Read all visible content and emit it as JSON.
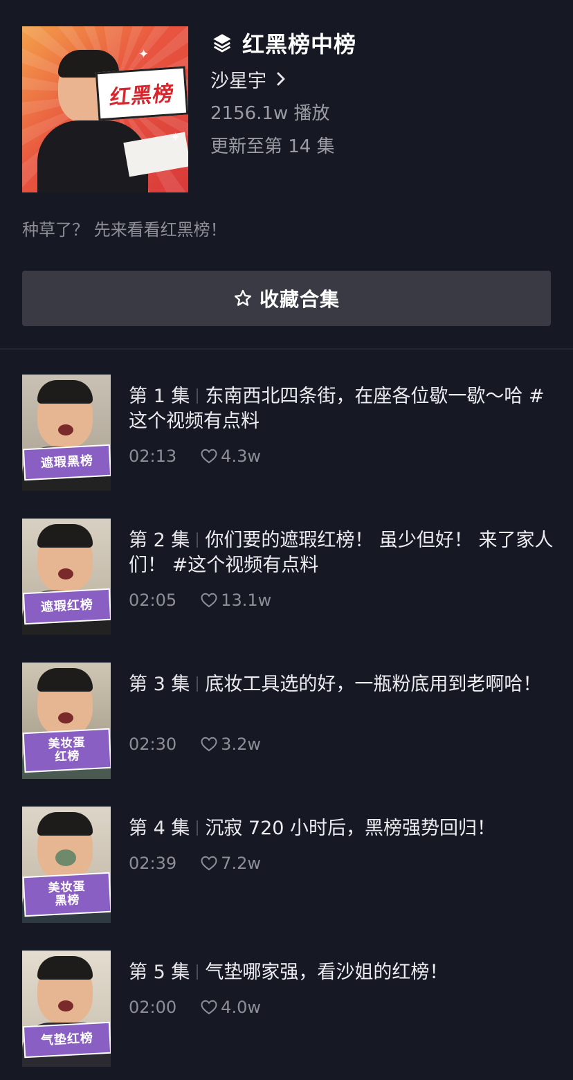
{
  "collection": {
    "cover_text": "红黑榜",
    "title": "红黑榜中榜",
    "author": "沙星宇",
    "plays": "2156.1w 播放",
    "updated": "更新至第 14 集",
    "description": "种草了？ 先来看看红黑榜！",
    "collect_label": "收藏合集"
  },
  "icons": {
    "title_icon": "layers-icon",
    "author_chevron": "chevron-right-icon",
    "collect_icon": "star-outline-icon",
    "like_icon": "heart-outline-icon"
  },
  "colors": {
    "background": "#161823",
    "button": "#393a43",
    "thumb_banner": "#8a5fc4"
  },
  "episodes": [
    {
      "number": "第 1 集",
      "title": "东南西北四条街，在座各位歇一歇～哈 #这个视频有点料",
      "duration": "02:13",
      "likes": "4.3w",
      "banner": [
        "遮瑕黑榜"
      ]
    },
    {
      "number": "第 2 集",
      "title": "你们要的遮瑕红榜！ 虽少但好！ 来了家人们！ #这个视频有点料",
      "duration": "02:05",
      "likes": "13.1w",
      "banner": [
        "遮瑕红榜"
      ]
    },
    {
      "number": "第 3 集",
      "title": "底妆工具选的好，一瓶粉底用到老啊哈！",
      "duration": "02:30",
      "likes": "3.2w",
      "banner": [
        "美妆蛋",
        "红榜"
      ]
    },
    {
      "number": "第 4 集",
      "title": "沉寂 720 小时后，黑榜强势回归！",
      "duration": "02:39",
      "likes": "7.2w",
      "banner": [
        "美妆蛋",
        "黑榜"
      ]
    },
    {
      "number": "第 5 集",
      "title": "气垫哪家强，看沙姐的红榜！",
      "duration": "02:00",
      "likes": "4.0w",
      "banner": [
        "气垫红榜"
      ]
    }
  ]
}
